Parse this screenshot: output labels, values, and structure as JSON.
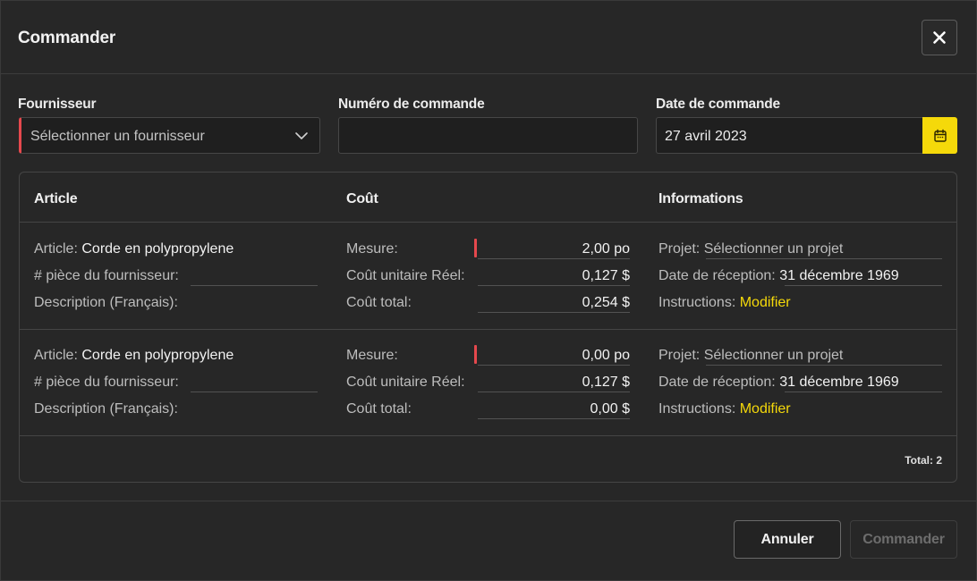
{
  "dialog": {
    "title": "Commander"
  },
  "form": {
    "supplier": {
      "label": "Fournisseur",
      "placeholder": "Sélectionner un fournisseur"
    },
    "order_number": {
      "label": "Numéro de commande",
      "value": ""
    },
    "order_date": {
      "label": "Date de commande",
      "value": "27 avril 2023"
    }
  },
  "table": {
    "headers": [
      "Article",
      "Coût",
      "Informations"
    ],
    "rows": [
      {
        "article_label": "Article:",
        "article_value": "Corde en polypropylene",
        "supplier_part_label": "# pièce du fournisseur:",
        "description_label": "Description (Français):",
        "measure_label": "Mesure:",
        "measure_value": "2,00 po",
        "unit_cost_label": "Coût unitaire Réel:",
        "unit_cost_value": "0,127 $",
        "total_cost_label": "Coût total:",
        "total_cost_value": "0,254 $",
        "project_label": "Projet:",
        "project_value": "Sélectionner un projet",
        "reception_label": "Date de réception:",
        "reception_value": "31 décembre 1969",
        "instructions_label": "Instructions:",
        "instructions_link": "Modifier"
      },
      {
        "article_label": "Article:",
        "article_value": "Corde en polypropylene",
        "supplier_part_label": "# pièce du fournisseur:",
        "description_label": "Description (Français):",
        "measure_label": "Mesure:",
        "measure_value": "0,00 po",
        "unit_cost_label": "Coût unitaire Réel:",
        "unit_cost_value": "0,127 $",
        "total_cost_label": "Coût total:",
        "total_cost_value": "0,00 $",
        "project_label": "Projet:",
        "project_value": "Sélectionner un projet",
        "reception_label": "Date de réception:",
        "reception_value": "31 décembre 1969",
        "instructions_label": "Instructions:",
        "instructions_link": "Modifier"
      }
    ],
    "total": "Total: 2"
  },
  "footer": {
    "cancel_label": "Annuler",
    "submit_label": "Commander"
  },
  "colors": {
    "accent": "#f5d90a",
    "required": "#e5484d",
    "background": "#272727"
  }
}
